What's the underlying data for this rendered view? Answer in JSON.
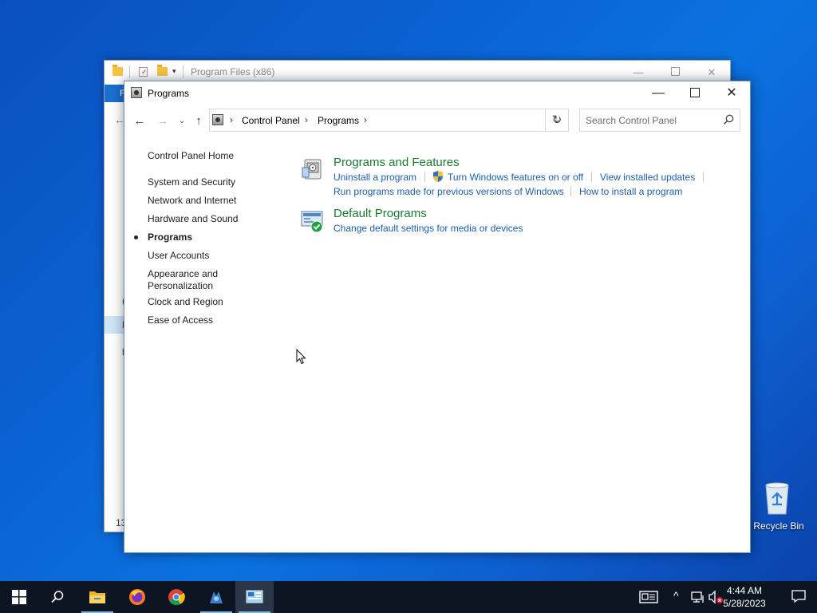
{
  "background_window": {
    "title": "Program Files (x86)",
    "ribbon_tab": "F",
    "status_fragment": "13",
    "fragments": [
      "(",
      "E",
      "l"
    ]
  },
  "window": {
    "title": "Programs",
    "minimize_label": "—",
    "close_label": "✕"
  },
  "nav": {
    "back": "←",
    "forward": "→",
    "recent": "⌄",
    "up": "↑",
    "breadcrumb": [
      "Control Panel",
      "Programs"
    ],
    "dropdown": "⌄",
    "refresh": "↻",
    "search_placeholder": "Search Control Panel"
  },
  "left_nav": {
    "home": "Control Panel Home",
    "items": [
      "System and Security",
      "Network and Internet",
      "Hardware and Sound",
      "Programs",
      "User Accounts",
      "Appearance and",
      "Personalization",
      "Clock and Region",
      "Ease of Access"
    ]
  },
  "categories": {
    "programs_features": {
      "title": "Programs and Features",
      "links": [
        "Uninstall a program",
        "Turn Windows features on or off",
        "View installed updates",
        "Run programs made for previous versions of Windows",
        "How to install a program"
      ]
    },
    "default_programs": {
      "title": "Default Programs",
      "links": [
        "Change default settings for media or devices"
      ]
    }
  },
  "desktop": {
    "recycle_bin": "Recycle Bin"
  },
  "taskbar": {
    "apps": [
      "start-button",
      "search-button",
      "file-explorer",
      "firefox",
      "chrome",
      "app-generic",
      "control-panel"
    ],
    "time": "4:44 AM",
    "date": "5/28/2023"
  },
  "colors": {
    "link": "#1c5fa8",
    "category_title": "#1a7a2f",
    "taskbar": "#0d1523",
    "desktop": "#0b63d3"
  }
}
